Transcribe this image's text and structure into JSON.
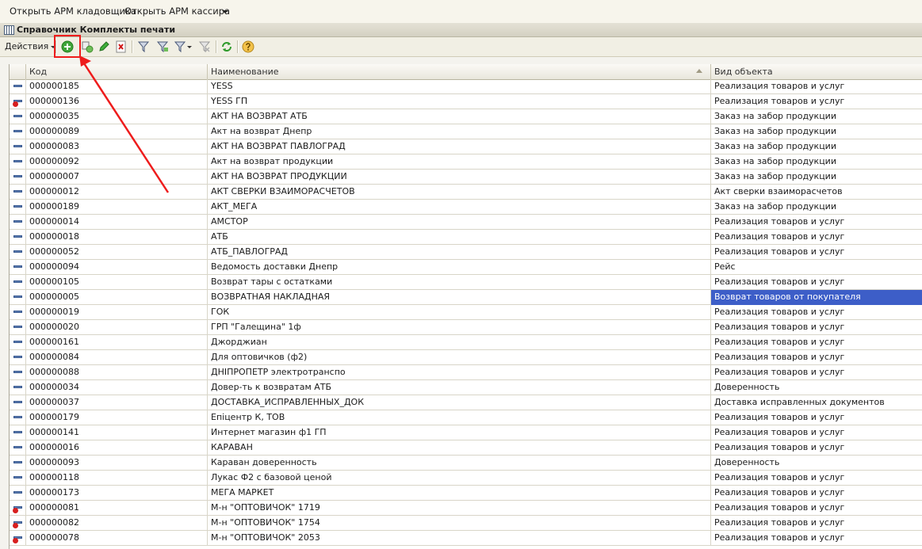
{
  "topbar": {
    "link1": "Открыть АРМ кладовщика",
    "link2": "Открыть АРМ кассира"
  },
  "window": {
    "title": "Справочник Комплекты печати"
  },
  "toolbar": {
    "actions_label": "Действия"
  },
  "columns": {
    "code": "Код",
    "name": "Наименование",
    "type": "Вид объекта"
  },
  "rows": [
    {
      "code": "000000185",
      "name": "YESS",
      "type": "Реализация товаров и услуг",
      "deleted": false
    },
    {
      "code": "000000136",
      "name": "YESS  ГП",
      "type": "Реализация товаров и услуг",
      "deleted": true
    },
    {
      "code": "000000035",
      "name": "АКТ НА ВОЗВРАТ АТБ",
      "type": "Заказ на забор продукции",
      "deleted": false
    },
    {
      "code": "000000089",
      "name": "Акт на возврат Днепр",
      "type": "Заказ на забор продукции",
      "deleted": false
    },
    {
      "code": "000000083",
      "name": "АКТ НА ВОЗВРАТ ПАВЛОГРАД",
      "type": "Заказ на забор продукции",
      "deleted": false
    },
    {
      "code": "000000092",
      "name": "Акт на возврат продукции",
      "type": "Заказ на забор продукции",
      "deleted": false
    },
    {
      "code": "000000007",
      "name": "АКТ НА ВОЗВРАТ ПРОДУКЦИИ",
      "type": "Заказ на забор продукции",
      "deleted": false
    },
    {
      "code": "000000012",
      "name": "АКТ СВЕРКИ ВЗАИМОРАСЧЕТОВ",
      "type": "Акт сверки взаиморасчетов",
      "deleted": false
    },
    {
      "code": "000000189",
      "name": "АКТ_МЕГА",
      "type": "Заказ на забор продукции",
      "deleted": false
    },
    {
      "code": "000000014",
      "name": "АМСТОР",
      "type": "Реализация товаров и услуг",
      "deleted": false
    },
    {
      "code": "000000018",
      "name": "АТБ",
      "type": "Реализация товаров и услуг",
      "deleted": false
    },
    {
      "code": "000000052",
      "name": "АТБ_ПАВЛОГРАД",
      "type": "Реализация товаров и услуг",
      "deleted": false
    },
    {
      "code": "000000094",
      "name": "Ведомость доставки Днепр",
      "type": "Рейс",
      "deleted": false
    },
    {
      "code": "000000105",
      "name": "Возврат тары с остатками",
      "type": "Реализация товаров и услуг",
      "deleted": false
    },
    {
      "code": "000000005",
      "name": "ВОЗВРАТНАЯ НАКЛАДНАЯ",
      "type": "Возврат товаров от покупателя",
      "deleted": false,
      "selected": true
    },
    {
      "code": "000000019",
      "name": "ГОК",
      "type": "Реализация товаров и услуг",
      "deleted": false
    },
    {
      "code": "000000020",
      "name": "ГРП \"Галещина\" 1ф",
      "type": "Реализация товаров и услуг",
      "deleted": false
    },
    {
      "code": "000000161",
      "name": "Джорджиан",
      "type": "Реализация товаров и услуг",
      "deleted": false
    },
    {
      "code": "000000084",
      "name": "Для оптовичков (ф2)",
      "type": "Реализация товаров и услуг",
      "deleted": false
    },
    {
      "code": "000000088",
      "name": "ДНІПРОПЕТР электротранспо",
      "type": "Реализация товаров и услуг",
      "deleted": false
    },
    {
      "code": "000000034",
      "name": "Довер-ть к возвратам АТБ",
      "type": "Доверенность",
      "deleted": false
    },
    {
      "code": "000000037",
      "name": "ДОСТАВКА_ИСПРАВЛЕННЫХ_ДОК",
      "type": "Доставка исправленных документов",
      "deleted": false
    },
    {
      "code": "000000179",
      "name": "Епіцентр К, ТОВ",
      "type": "Реализация товаров и услуг",
      "deleted": false
    },
    {
      "code": "000000141",
      "name": "Интернет магазин ф1 ГП",
      "type": "Реализация товаров и услуг",
      "deleted": false
    },
    {
      "code": "000000016",
      "name": "КАРАВАН",
      "type": "Реализация товаров и услуг",
      "deleted": false
    },
    {
      "code": "000000093",
      "name": "Караван доверенность",
      "type": "Доверенность",
      "deleted": false
    },
    {
      "code": "000000118",
      "name": "Лукас Ф2 с базовой ценой",
      "type": "Реализация товаров и услуг",
      "deleted": false
    },
    {
      "code": "000000173",
      "name": "МЕГА МАРКЕТ",
      "type": "Реализация товаров и услуг",
      "deleted": false
    },
    {
      "code": "000000081",
      "name": "М-н \"ОПТОВИЧОК\" 1719",
      "type": "Реализация товаров и услуг",
      "deleted": true
    },
    {
      "code": "000000082",
      "name": "М-н \"ОПТОВИЧОК\" 1754",
      "type": "Реализация товаров и услуг",
      "deleted": true
    },
    {
      "code": "000000078",
      "name": "М-н \"ОПТОВИЧОК\" 2053",
      "type": "Реализация товаров и услуг",
      "deleted": true
    }
  ],
  "colors": {
    "selection": "#3d5ec8",
    "annotation": "#ee1c1c"
  }
}
